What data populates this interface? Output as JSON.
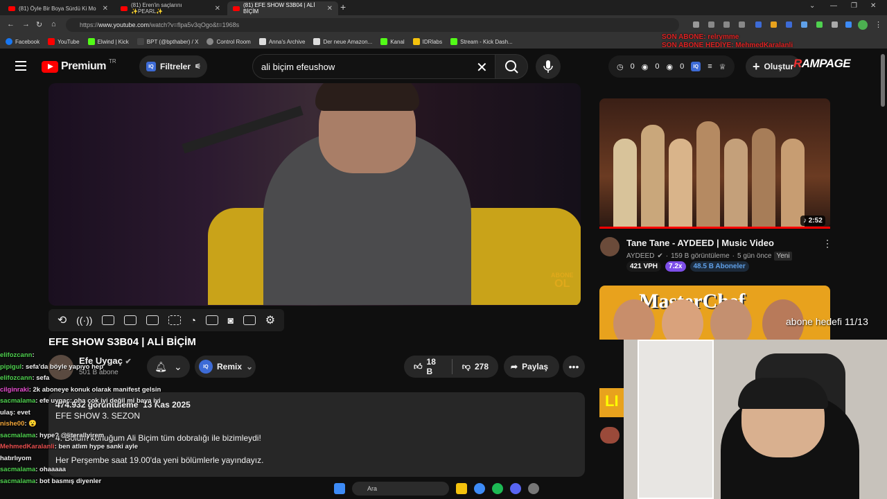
{
  "browser": {
    "tabs": [
      {
        "label": "(81) Öyle Bir Boya Sürdü Ki Mo"
      },
      {
        "label": "(81) Eren'in saçlarını ✨PEARL✨"
      },
      {
        "label": "(81) EFE SHOW S3B04 | ALİ BİÇİM"
      }
    ],
    "new_tab": "+",
    "url_prefix": "https://",
    "url_host": "www.youtube.com",
    "url_path": "/watch?v=flpa5v3qOgo&t=1968s",
    "bookmarks": [
      {
        "label": "Facebook",
        "color": "#1877f2"
      },
      {
        "label": "YouTube",
        "color": "#ff0000"
      },
      {
        "label": "Elwind | Kick",
        "color": "#53fc18"
      },
      {
        "label": "BPT (@bpthaber) / X",
        "color": "#444444"
      },
      {
        "label": "Control Room",
        "color": "#888888"
      },
      {
        "label": "Anna's Archive",
        "color": "#dddddd"
      },
      {
        "label": "Der neue Amazon...",
        "color": "#dddddd"
      },
      {
        "label": "Kanal",
        "color": "#53fc18"
      },
      {
        "label": "IDRlabs",
        "color": "#f4c20d"
      },
      {
        "label": "Stream - Kick Dash...",
        "color": "#53fc18"
      }
    ]
  },
  "header": {
    "logo": "Premium",
    "logo_region": "TR",
    "filters_label": "Filtreler",
    "search_value": "ali biçim efeushow",
    "stats": [
      "0",
      "0",
      "0"
    ],
    "create_label": "Oluştur",
    "rampage": "RAMPAGE"
  },
  "overlay": {
    "line1": "SON ABONE: relrymme",
    "line2": "SON ABONE HEDİYE: MehmedKaralanli",
    "goal": "abone hedefi 11/13"
  },
  "video": {
    "abone_top": "ABONE",
    "abone_bottom": "OL",
    "title": "EFE SHOW S3B04 | ALİ BİÇİM",
    "channel_name": "Efe Uygaç",
    "channel_subs": "501 B abone",
    "remix_label": "Remix",
    "likes": "18 B",
    "dislikes": "278",
    "share_label": "Paylaş",
    "views": "474.932 görüntüleme",
    "date": "13 Kas 2025",
    "desc_lines": [
      "EFE SHOW 3. SEZON",
      "",
      "4. Bölüm konuğum Ali Biçim tüm dobralığı ile bizimleydi!",
      "",
      "Her Perşembe saat 19.00'da yeni bölümlerle yayındayız."
    ]
  },
  "sidebar": {
    "v1": {
      "duration": "2:52",
      "title": "Tane Tane - AYDEED | Music Video",
      "channel": "AYDEED",
      "views": "159 B görüntüleme",
      "age": "5 gün önce",
      "new": "Yeni",
      "vph": "421 VPH",
      "ratio": "7.2x",
      "subs": "48.5 B Aboneler"
    },
    "v2": {
      "title": "MasterChef",
      "tag": "LI"
    }
  },
  "chat": [
    {
      "user": "elifozcann",
      "msg": ": ",
      "color": "#4fd14f"
    },
    {
      "user": "pipigul",
      "msg": ": sefa'da böyle yapıyo hep",
      "color": "#4fd14f"
    },
    {
      "user": "elifozcann",
      "msg": ": sefa",
      "color": "#4fd14f"
    },
    {
      "user": "cilginraki",
      "msg": ": 2k aboneye konuk olarak manifest gelsin",
      "color": "#e84fd1"
    },
    {
      "user": "sacmalama",
      "msg": ": efe uygaç: oha çok iyi değil mi baya iyi",
      "color": "#4fd14f"
    },
    {
      "user": "",
      "msg": "ulaş: evet",
      "color": "#ffffff"
    },
    {
      "user": "nishe00",
      "msg": ": 😮",
      "color": "#f4a83a"
    },
    {
      "user": "sacmalama",
      "msg": ": hype? @literallyirem",
      "color": "#4fd14f"
    },
    {
      "user": "MehmedKaralanli",
      "msg": ": ben atlım hype sanki ayle",
      "color": "#e84f4f"
    },
    {
      "user": "",
      "msg": "hatırlıyom",
      "color": "#ffffff"
    },
    {
      "user": "sacmalama",
      "msg": ": ohaaaaa",
      "color": "#4fd14f"
    },
    {
      "user": "sacmalama",
      "msg": ": bot basmış diyenler",
      "color": "#4fd14f"
    }
  ],
  "taskbar": {
    "search_placeholder": "Ara"
  }
}
